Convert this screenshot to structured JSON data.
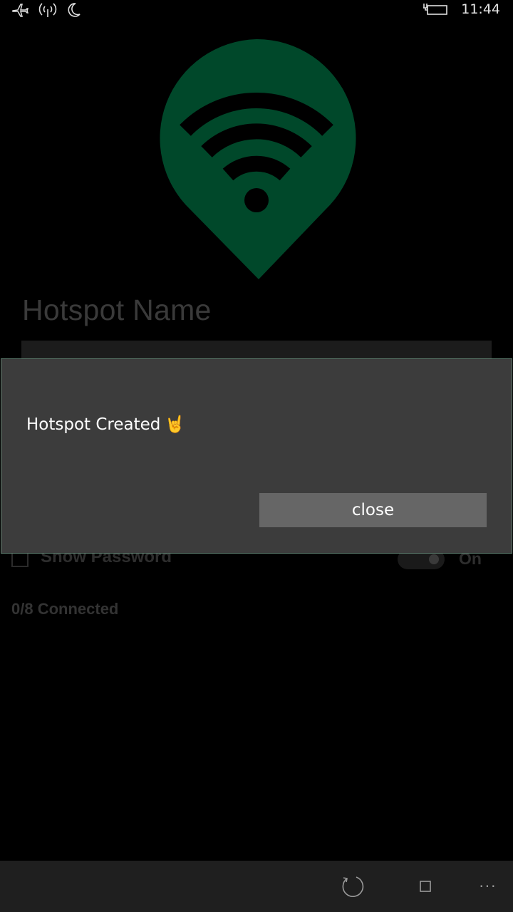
{
  "status_bar": {
    "time": "11:44",
    "icons": [
      "airplane-icon",
      "antenna-icon",
      "moon-icon",
      "battery-charging-icon"
    ]
  },
  "logo": {
    "icon": "wifi-location-pin-icon",
    "color": "#00482a"
  },
  "form": {
    "name_placeholder": "Hotspot Name",
    "show_password_label": "Show Password",
    "toggle_state_label": "On",
    "connected_label": "0/8 Connected"
  },
  "dialog": {
    "message": "Hotspot Created",
    "emoji": "🤘",
    "close_label": "close"
  },
  "app_bar": {
    "buttons": [
      "refresh-icon",
      "stop-icon",
      "more-icon"
    ],
    "more_label": "···"
  },
  "colors": {
    "dialog_background": "#3c3c3c",
    "button_background": "#666666",
    "accent_green": "#00482a"
  }
}
